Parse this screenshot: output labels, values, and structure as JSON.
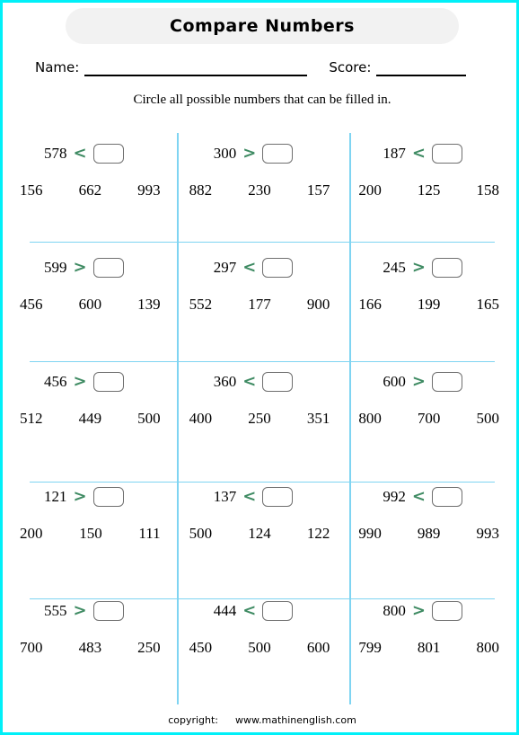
{
  "header": {
    "title": "Compare Numbers",
    "name_label": "Name:",
    "score_label": "Score:",
    "instruction": "Circle all possible numbers that  can be filled in."
  },
  "colors": {
    "page_border": "#00f0f8",
    "grid_line": "#7fd4f2",
    "operator": "#3f8b63",
    "banner_bg": "#f2f2f2",
    "answer_box_border": "#6f6f6f"
  },
  "problems": [
    {
      "number": "578",
      "operator": "<",
      "choices": [
        "156",
        "662",
        "993"
      ]
    },
    {
      "number": "300",
      "operator": ">",
      "choices": [
        "882",
        "230",
        "157"
      ]
    },
    {
      "number": "187",
      "operator": "<",
      "choices": [
        "200",
        "125",
        "158"
      ]
    },
    {
      "number": "599",
      "operator": ">",
      "choices": [
        "456",
        "600",
        "139"
      ]
    },
    {
      "number": "297",
      "operator": "<",
      "choices": [
        "552",
        "177",
        "900"
      ]
    },
    {
      "number": "245",
      "operator": ">",
      "choices": [
        "166",
        "199",
        "165"
      ]
    },
    {
      "number": "456",
      "operator": ">",
      "choices": [
        "512",
        "449",
        "500"
      ]
    },
    {
      "number": "360",
      "operator": "<",
      "choices": [
        "400",
        "250",
        "351"
      ]
    },
    {
      "number": "600",
      "operator": ">",
      "choices": [
        "800",
        "700",
        "500"
      ]
    },
    {
      "number": "121",
      "operator": ">",
      "choices": [
        "200",
        "150",
        "111"
      ]
    },
    {
      "number": "137",
      "operator": "<",
      "choices": [
        "500",
        "124",
        "122"
      ]
    },
    {
      "number": "992",
      "operator": "<",
      "choices": [
        "990",
        "989",
        "993"
      ]
    },
    {
      "number": "555",
      "operator": ">",
      "choices": [
        "700",
        "483",
        "250"
      ]
    },
    {
      "number": "444",
      "operator": "<",
      "choices": [
        "450",
        "500",
        "600"
      ]
    },
    {
      "number": "800",
      "operator": ">",
      "choices": [
        "799",
        "801",
        "800"
      ]
    }
  ],
  "footer": {
    "copyright_label": "copyright:",
    "url": "www.mathinenglish.com"
  }
}
